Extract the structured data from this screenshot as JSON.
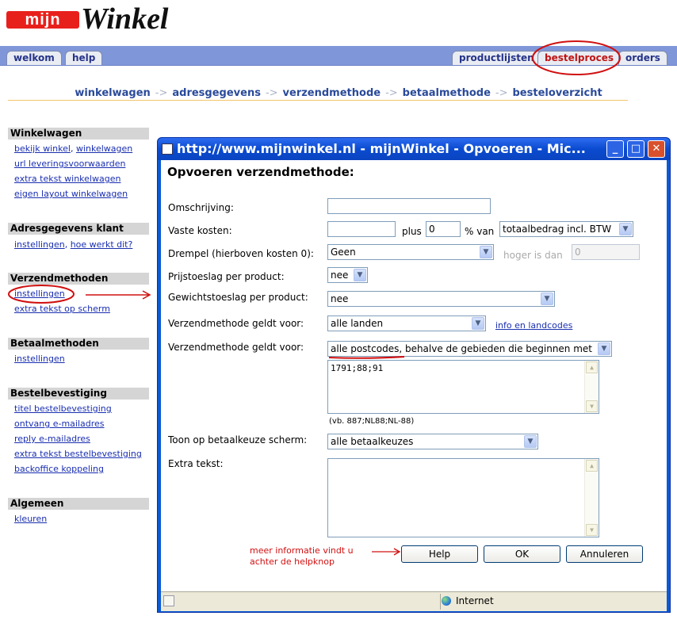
{
  "logo": {
    "prefix": "mijn",
    "name": "Winkel"
  },
  "tabs_left": [
    "welkom",
    "help"
  ],
  "tabs_right": [
    "productlijsten",
    "bestelproces",
    "orders"
  ],
  "active_tab": "bestelproces",
  "breadcrumb": [
    "winkelwagen",
    "adresgegevens",
    "verzendmethode",
    "betaalmethode",
    "besteloverzicht"
  ],
  "breadcrumb_separator": "->",
  "sidebar": {
    "winkelwagen": {
      "title": "Winkelwagen",
      "items": [
        "bekijk winkel",
        "winkelwagen",
        "url leveringsvoorwaarden",
        "extra tekst winkelwagen",
        "eigen layout winkelwagen"
      ]
    },
    "adres": {
      "title": "Adresgegevens klant",
      "items": [
        "instellingen",
        "hoe werkt dit?"
      ]
    },
    "verzend": {
      "title": "Verzendmethoden",
      "items": [
        "instellingen",
        "extra tekst op scherm"
      ]
    },
    "betaal": {
      "title": "Betaalmethoden",
      "items": [
        "instellingen"
      ]
    },
    "bestel": {
      "title": "Bestelbevestiging",
      "items": [
        "titel bestelbevestiging",
        "ontvang e-mailadres",
        "reply e-mailadres",
        "extra tekst bestelbevestiging",
        "backoffice koppeling"
      ]
    },
    "algemeen": {
      "title": "Algemeen",
      "items": [
        "kleuren"
      ]
    }
  },
  "dialog": {
    "window_title": "http://www.mijnwinkel.nl - mijnWinkel - Opvoeren - Mic...",
    "heading": "Opvoeren verzendmethode:",
    "fields": {
      "omschrijving": {
        "label": "Omschrijving:",
        "value": ""
      },
      "vaste_kosten": {
        "label": "Vaste kosten:",
        "value": "",
        "plus": "plus",
        "percent_value": "0",
        "percent_label": "% van",
        "basis": "totaalbedrag incl. BTW"
      },
      "drempel": {
        "label": "Drempel (hierboven kosten 0):",
        "value": "Geen",
        "hoger_label": "hoger is dan",
        "hoger_value": "0"
      },
      "prijstoeslag": {
        "label": "Prijstoeslag per product:",
        "value": "nee"
      },
      "gewichtstoeslag": {
        "label": "Gewichtstoeslag per product:",
        "value": "nee"
      },
      "geldt_landen": {
        "label": "Verzendmethode geldt voor:",
        "value": "alle landen",
        "link": "info en landcodes"
      },
      "geldt_postcodes": {
        "label": "Verzendmethode geldt voor:",
        "value": "alle postcodes, behalve de gebieden die beginnen met",
        "textarea": "1791;88;91",
        "hint": "(vb. 887;NL88;NL-88)"
      },
      "toon": {
        "label": "Toon op betaalkeuze scherm:",
        "value": "alle betaalkeuzes"
      },
      "extra": {
        "label": "Extra tekst:",
        "value": ""
      }
    },
    "buttons": {
      "help": "Help",
      "ok": "OK",
      "cancel": "Annuleren"
    },
    "status": "Internet"
  },
  "annotation": {
    "line1": "meer informatie vindt u",
    "line2": "achter de helpknop"
  },
  "colors": {
    "tabbar": "#7f97d8",
    "annotation_red": "#d01010",
    "link_blue": "#1a2fb0",
    "titlebar_blue": "#0a4bd0"
  }
}
